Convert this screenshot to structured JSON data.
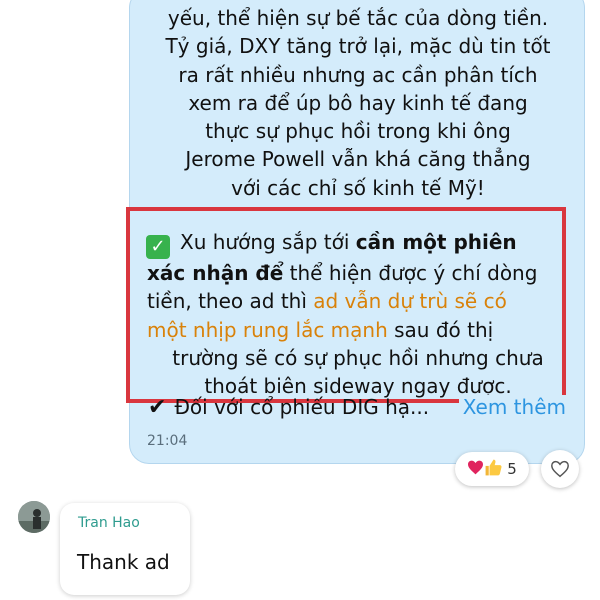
{
  "message": {
    "para1_lines": [
      "yếu, thể hiện sự bế tắc của dòng tiền.",
      "Tỷ giá, DXY tăng trở lại, mặc dù tin tốt",
      "ra rất nhiều nhưng ac cần phân tích",
      "xem ra để úp bô hay kinh tế đang",
      "thực sự phục hồi trong khi ông",
      "Jerome Powell vẫn khá căng thẳng",
      "với các chỉ số kinh tế Mỹ!"
    ],
    "para2": {
      "check_icon": "✓",
      "l1_text": "Xu hướng sắp tới ",
      "l1_bold": "cần một phiên",
      "l2_bold": "xác nhận để",
      "l2_text": " thể hiện được ý chí dòng",
      "l3_text": "tiền, theo ad thì ",
      "l3_orange": "ad vẫn dự trù sẽ có",
      "l4_orange": "một nhịp rung lắc mạnh",
      "l4_text": " sau đó thị",
      "l5": "trường sẽ có sự phục hồi nhưng chưa",
      "l6": "thoát biên sideway ngay được."
    },
    "line3_icon": "✔",
    "line3_text": "Đối với cổ phiếu DIG hạ...",
    "see_more": "Xem thêm",
    "time": "21:04"
  },
  "reactions": {
    "heart_icon": "heart-icon",
    "thumb_icon": "thumbs-up-icon",
    "count": "5"
  },
  "reply": {
    "sender": "Tran Hao",
    "text": "Thank ad"
  },
  "colors": {
    "bubble": "#d4ecfb",
    "highlight_border": "#d9363e",
    "orange_text": "#d9820a",
    "link": "#2d95e0",
    "sender": "#2f9c8f"
  }
}
